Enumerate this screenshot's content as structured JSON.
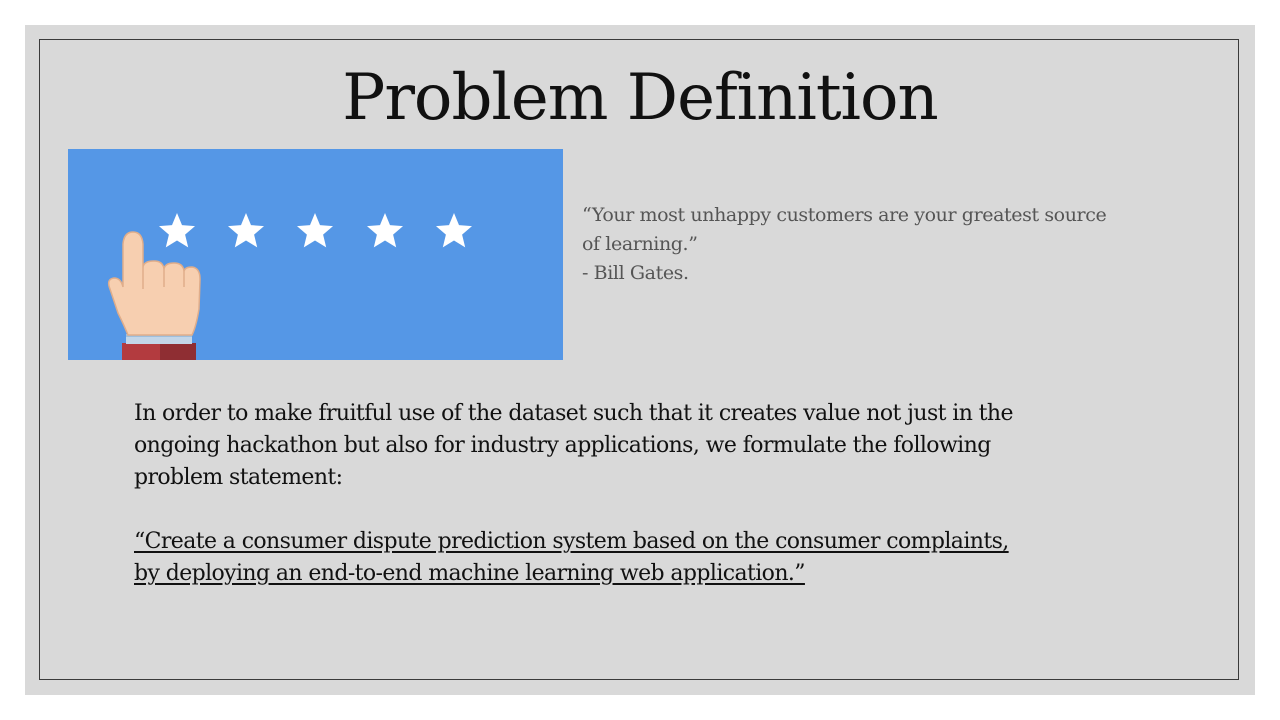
{
  "slide": {
    "title": "Problem Definition",
    "quote": {
      "line1": "“Your most unhappy customers are your greatest source",
      "line2": "of learning.”",
      "author": "- Bill Gates."
    },
    "body": {
      "line1": "In order to make fruitful use of the dataset such that it creates value not just in the",
      "line2": "ongoing hackathon but also for industry applications, we formulate the following",
      "line3": "problem statement:"
    },
    "statement": {
      "line1": "“Create a consumer dispute prediction system based on the consumer complaints,",
      "line2": "by deploying an end-to-end machine learning web application.”"
    },
    "image": {
      "icon": "five-star-rating-hand-icon",
      "star_count": 5,
      "background_color": "#5597e6"
    }
  }
}
